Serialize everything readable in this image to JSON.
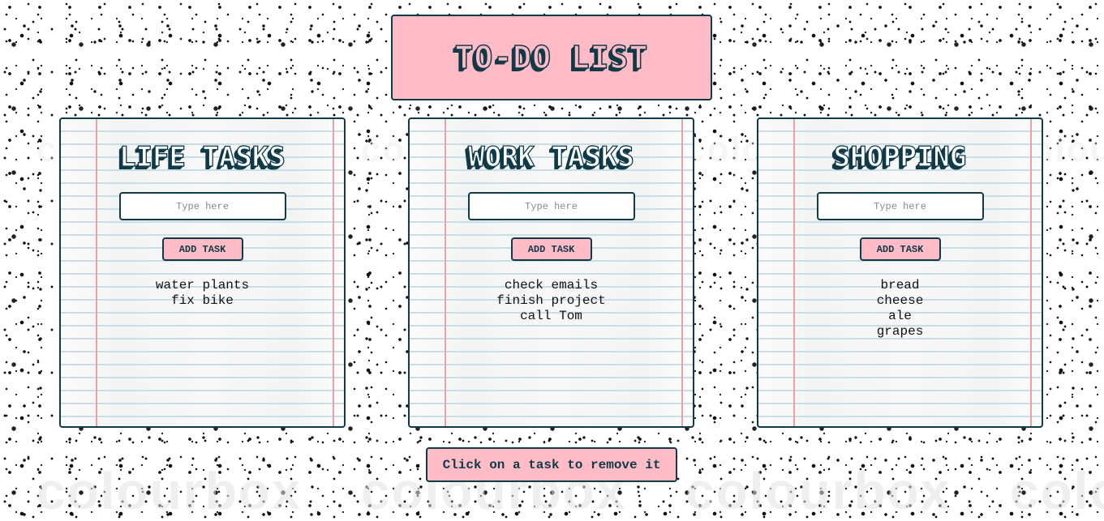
{
  "app": {
    "title": "TO-DO LIST",
    "watermark": "colourbox"
  },
  "colors": {
    "accent_pink": "#ffbbc6",
    "border_dark_teal": "#0f3a48",
    "paper_line_blue": "#c8dde6",
    "paper_margin_red": "#e9a0a8"
  },
  "lists": [
    {
      "id": "life",
      "heading": "LIFE TASKS",
      "input": {
        "value": "",
        "placeholder": "Type here"
      },
      "add_button_label": "ADD TASK",
      "tasks": [
        "water plants",
        "fix bike"
      ]
    },
    {
      "id": "work",
      "heading": "WORK TASKS",
      "input": {
        "value": "",
        "placeholder": "Type here"
      },
      "add_button_label": "ADD TASK",
      "tasks": [
        "check emails",
        "finish project",
        "call Tom"
      ]
    },
    {
      "id": "shopping",
      "heading": "SHOPPING",
      "input": {
        "value": "",
        "placeholder": "Type here"
      },
      "add_button_label": "ADD TASK",
      "tasks": [
        "bread",
        "cheese",
        "ale",
        "grapes"
      ]
    }
  ],
  "footer": {
    "hint": "Click on a task to remove it"
  }
}
